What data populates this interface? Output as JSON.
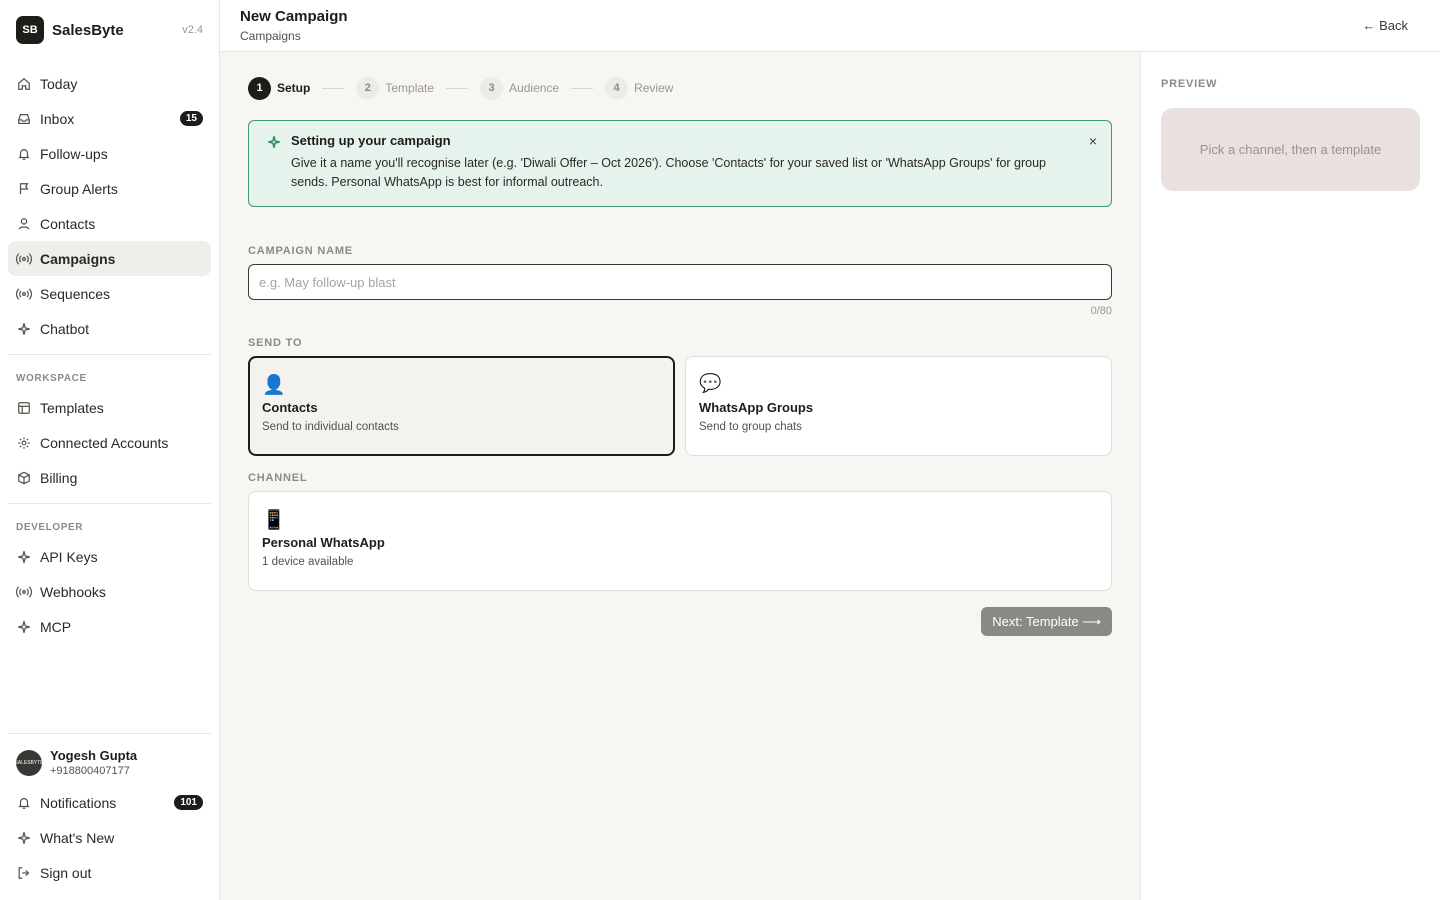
{
  "brand": {
    "initials": "SB",
    "name": "SalesByte",
    "version": "v2.4"
  },
  "nav": [
    {
      "label": "Today",
      "icon": "home-icon"
    },
    {
      "label": "Inbox",
      "icon": "inbox-icon",
      "badge": "15"
    },
    {
      "label": "Follow-ups",
      "icon": "bell-icon"
    },
    {
      "label": "Group Alerts",
      "icon": "flag-icon"
    },
    {
      "label": "Contacts",
      "icon": "user-icon"
    },
    {
      "label": "Campaigns",
      "icon": "broadcast-icon",
      "active": true
    },
    {
      "label": "Sequences",
      "icon": "broadcast-icon"
    },
    {
      "label": "Chatbot",
      "icon": "sparkle-icon"
    }
  ],
  "workspace": {
    "label": "WORKSPACE",
    "items": [
      {
        "label": "Templates",
        "icon": "template-icon"
      },
      {
        "label": "Connected Accounts",
        "icon": "gear-icon"
      },
      {
        "label": "Billing",
        "icon": "box-icon"
      }
    ]
  },
  "developer": {
    "label": "DEVELOPER",
    "items": [
      {
        "label": "API Keys",
        "icon": "sparkle-icon"
      },
      {
        "label": "Webhooks",
        "icon": "broadcast-icon"
      },
      {
        "label": "MCP",
        "icon": "sparkle-icon"
      }
    ]
  },
  "user": {
    "name": "Yogesh Gupta",
    "phone": "+918800407177",
    "avatar_text": "SALESBYTE"
  },
  "footer_nav": [
    {
      "label": "Notifications",
      "icon": "bell-icon",
      "badge": "101"
    },
    {
      "label": "What's New",
      "icon": "sparkle-icon"
    },
    {
      "label": "Sign out",
      "icon": "sign-out-icon"
    }
  ],
  "header": {
    "title": "New Campaign",
    "breadcrumb": "Campaigns",
    "back": "← Back"
  },
  "stepper": [
    {
      "num": "1",
      "label": "Setup",
      "active": true
    },
    {
      "num": "2",
      "label": "Template"
    },
    {
      "num": "3",
      "label": "Audience"
    },
    {
      "num": "4",
      "label": "Review"
    }
  ],
  "info": {
    "title": "Setting up your campaign",
    "text": "Give it a name you'll recognise later (e.g. 'Diwali Offer – Oct 2026'). Choose 'Contacts' for your saved list or 'WhatsApp Groups' for group sends. Personal WhatsApp is best for informal outreach.",
    "close": "×"
  },
  "campaign_name": {
    "label": "CAMPAIGN NAME",
    "placeholder": "e.g. May follow-up blast",
    "value": "",
    "counter": "0/80"
  },
  "send_to": {
    "label": "SEND TO",
    "options": [
      {
        "icon": "👤",
        "title": "Contacts",
        "subtitle": "Send to individual contacts",
        "selected": true
      },
      {
        "icon": "💬",
        "title": "WhatsApp Groups",
        "subtitle": "Send to group chats",
        "selected": false
      }
    ]
  },
  "channel": {
    "label": "CHANNEL",
    "option": {
      "icon": "📱",
      "title": "Personal WhatsApp",
      "subtitle": "1 device available"
    }
  },
  "next_button": "Next: Template ⟶",
  "preview": {
    "label": "PREVIEW",
    "placeholder": "Pick a channel, then a template"
  },
  "colors": {
    "accent": "#1f1d1a",
    "info_border": "#3f9a6d",
    "info_bg": "#e6f3ec",
    "preview_bg": "#e8e1dd",
    "button_disabled": "#8b8986"
  }
}
